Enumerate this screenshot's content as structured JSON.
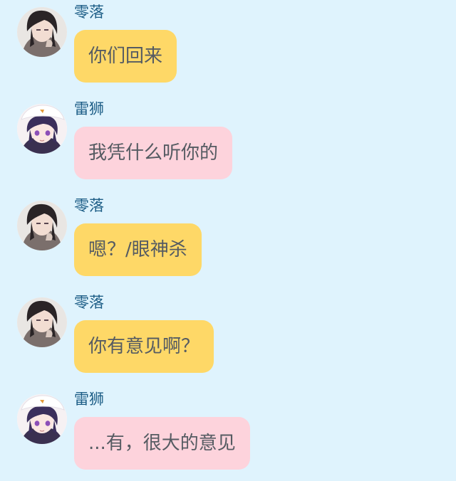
{
  "colors": {
    "background": "#dff3fd",
    "name_text": "#1c5d86",
    "message_text": "#555b62",
    "bubble_yellow": "#fed867",
    "bubble_pink": "#fdd3dc"
  },
  "messages": [
    {
      "sender": "零落",
      "text": "你们回来",
      "bubble": "yellow",
      "avatar": "dark-haired-boy-avatar"
    },
    {
      "sender": "雷狮",
      "text": "我凭什么听你的",
      "bubble": "pink",
      "avatar": "purple-haired-boy-white-hat-avatar"
    },
    {
      "sender": "零落",
      "text": "嗯？/眼神杀",
      "bubble": "yellow",
      "avatar": "dark-haired-boy-avatar"
    },
    {
      "sender": "零落",
      "text": "你有意见啊？",
      "bubble": "yellow",
      "avatar": "dark-haired-boy-avatar"
    },
    {
      "sender": "雷狮",
      "text": "...有，很大的意见",
      "bubble": "pink",
      "avatar": "purple-haired-boy-white-hat-avatar"
    }
  ]
}
